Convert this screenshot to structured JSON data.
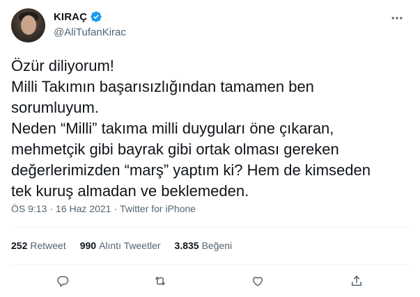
{
  "author": {
    "display_name": "KIRAÇ",
    "handle": "@AliTufanKirac",
    "verified": true
  },
  "tweet": {
    "lines": [
      "Özür diliyorum!",
      "Milli Takımın başarısızlığından tamamen ben",
      "sorumluyum.",
      "Neden “Milli” takıma milli duyguları öne çıkaran,",
      "mehmetçik gibi bayrak gibi ortak olması gereken",
      "değerlerimizden “marş” yaptım ki? Hem de kimseden",
      "tek kuruş almadan ve beklemeden."
    ]
  },
  "meta": {
    "time": "ÖS 9:13",
    "date": "16 Haz 2021",
    "separator": "·",
    "source": "Twitter for iPhone"
  },
  "stats": {
    "retweets": {
      "count": "252",
      "label": "Retweet"
    },
    "quotes": {
      "count": "990",
      "label": "Alıntı Tweetler"
    },
    "likes": {
      "count": "3.835",
      "label": "Beğeni"
    }
  },
  "icons": {
    "more": "more-dots-icon",
    "reply": "reply-icon",
    "retweet": "retweet-icon",
    "like": "heart-icon",
    "share": "share-icon",
    "verified": "verified-badge-icon"
  },
  "colors": {
    "verified_blue": "#1d9bf0",
    "secondary_text": "#536471",
    "primary_text": "#0f1419"
  }
}
